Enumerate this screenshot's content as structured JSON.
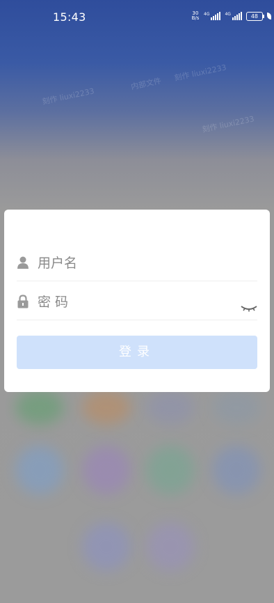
{
  "status_bar": {
    "time": "15:43",
    "net_speed_value": "30",
    "net_speed_unit": "B/s",
    "signal1_label": "4G",
    "signal2_label": "4G",
    "battery": "48"
  },
  "watermark": {
    "doc": "内部文件",
    "user": "刻作 liuxi2233"
  },
  "login": {
    "username_placeholder": "用户名",
    "password_placeholder": "密 码",
    "submit_label": "登录"
  }
}
